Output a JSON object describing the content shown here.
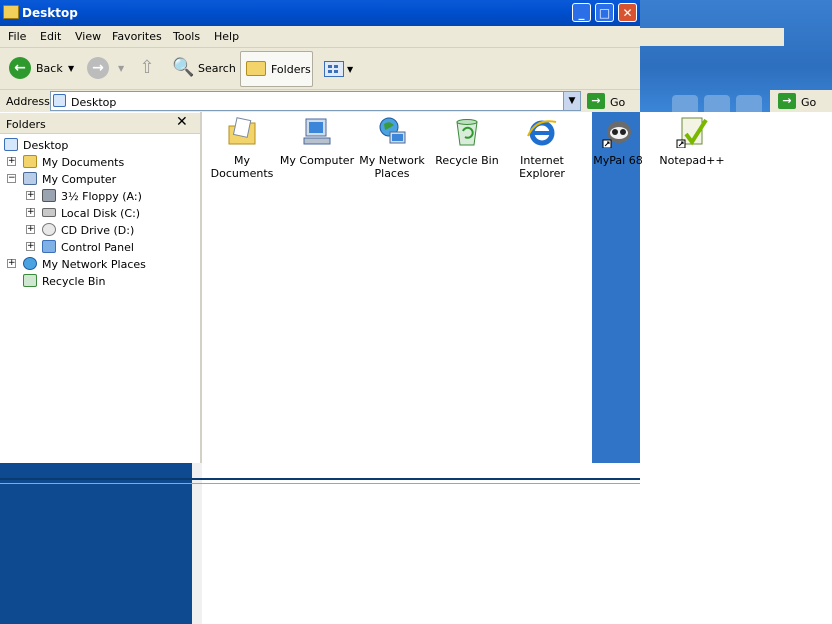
{
  "window": {
    "title": "Desktop"
  },
  "menu": [
    "File",
    "Edit",
    "View",
    "Favorites",
    "Tools",
    "Help"
  ],
  "toolbar": {
    "back_label": "Back",
    "search_label": "Search",
    "folders_label": "Folders"
  },
  "address": {
    "label": "Address",
    "value": "Desktop",
    "go_label": "Go"
  },
  "folders_pane": {
    "title": "Folders",
    "close_glyph": "✕",
    "tree": [
      {
        "label": "Desktop",
        "level": 0,
        "expander": ""
      },
      {
        "label": "My Documents",
        "level": 1,
        "expander": "+"
      },
      {
        "label": "My Computer",
        "level": 1,
        "expander": "−"
      },
      {
        "label": "3½ Floppy (A:)",
        "level": 2,
        "expander": "+"
      },
      {
        "label": "Local Disk (C:)",
        "level": 2,
        "expander": "+"
      },
      {
        "label": "CD Drive (D:)",
        "level": 2,
        "expander": "+"
      },
      {
        "label": "Control Panel",
        "level": 2,
        "expander": "+"
      },
      {
        "label": "My Network Places",
        "level": 1,
        "expander": "+"
      },
      {
        "label": "Recycle Bin",
        "level": 1,
        "expander": ""
      }
    ]
  },
  "desktop_icons": [
    {
      "label": "My Documents",
      "icon": "my-documents-icon"
    },
    {
      "label": "My Computer",
      "icon": "my-computer-icon"
    },
    {
      "label": "My Network Places",
      "icon": "network-places-icon"
    },
    {
      "label": "Recycle Bin",
      "icon": "recycle-bin-icon"
    },
    {
      "label": "Internet Explorer",
      "icon": "internet-explorer-icon"
    },
    {
      "label": "MyPal 68",
      "icon": "mypal-icon"
    },
    {
      "label": "Notepad++",
      "icon": "notepadpp-icon"
    }
  ],
  "colors": {
    "titlebar": "#0050d0",
    "chrome": "#ece9d8",
    "desktop_blue": "#2f74c6",
    "go_green": "#2e9a2e"
  }
}
